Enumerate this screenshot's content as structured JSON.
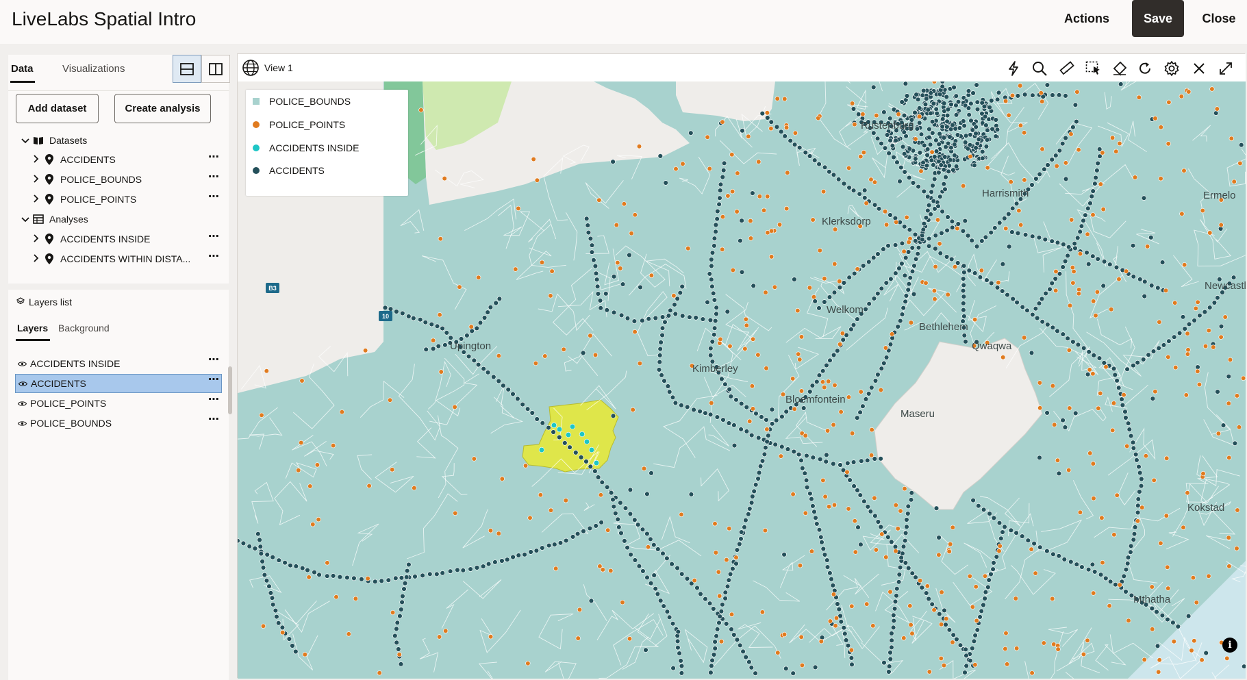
{
  "header": {
    "title": "LiveLabs Spatial Intro",
    "actions_label": "Actions",
    "save_label": "Save",
    "close_label": "Close"
  },
  "left_panel": {
    "tabs": [
      {
        "label": "Data",
        "active": true
      },
      {
        "label": "Visualizations",
        "active": false
      }
    ],
    "add_dataset_label": "Add dataset",
    "create_analysis_label": "Create analysis",
    "tree": {
      "datasets_label": "Datasets",
      "datasets": [
        "ACCIDENTS",
        "POLICE_BOUNDS",
        "POLICE_POINTS"
      ],
      "analyses_label": "Analyses",
      "analyses": [
        "ACCIDENTS INSIDE",
        "ACCIDENTS WITHIN DISTA..."
      ]
    },
    "more_label": "⋯"
  },
  "layers_panel": {
    "title": "Layers list",
    "tabs": [
      {
        "label": "Layers",
        "active": true
      },
      {
        "label": "Background",
        "active": false
      }
    ],
    "layers": [
      {
        "label": "ACCIDENTS INSIDE",
        "selected": false
      },
      {
        "label": "ACCIDENTS",
        "selected": true
      },
      {
        "label": "POLICE_POINTS",
        "selected": false
      },
      {
        "label": "POLICE_BOUNDS",
        "selected": false
      }
    ]
  },
  "map": {
    "view_title": "View 1",
    "toolbar_icons": [
      "lightning-icon",
      "search-icon",
      "ruler-icon",
      "select-area-icon",
      "eraser-icon",
      "refresh-icon",
      "settings-icon",
      "close-icon",
      "expand-icon"
    ],
    "legend": [
      {
        "label": "POLICE_BOUNDS",
        "color": "#a8d2ce",
        "shape": "square"
      },
      {
        "label": "POLICE_POINTS",
        "color": "#e07b1f",
        "shape": "circle"
      },
      {
        "label": "ACCIDENTS INSIDE",
        "color": "#1ec6c6",
        "shape": "circle"
      },
      {
        "label": "ACCIDENTS",
        "color": "#24505a",
        "shape": "circle"
      }
    ],
    "place_labels": [
      {
        "text": "Upington"
      },
      {
        "text": "Kimberley"
      },
      {
        "text": "Bloemfontein"
      },
      {
        "text": "Maseru"
      },
      {
        "text": "Welkom"
      },
      {
        "text": "Klerksdorp"
      },
      {
        "text": "Bethlehem"
      },
      {
        "text": "Harrismith"
      },
      {
        "text": "Newcastle"
      },
      {
        "text": "Ermelo"
      },
      {
        "text": "Kokstad"
      },
      {
        "text": "Mthatha"
      },
      {
        "text": "Qwaqwa"
      },
      {
        "text": "Rustenburg"
      }
    ],
    "road_shields": [
      "B3",
      "10"
    ],
    "info_label": "i",
    "colors": {
      "land": "#a8d2ce",
      "foreign_land": "#efedea",
      "highlight": "#dfe64a",
      "police_points": "#e07b1f",
      "accidents": "#24505a",
      "accidents_inside": "#1ec6c6"
    }
  }
}
